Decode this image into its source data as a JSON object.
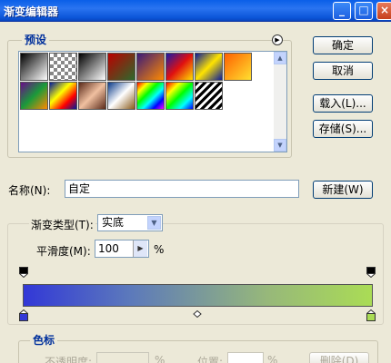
{
  "window": {
    "title": "渐变编辑器",
    "controls": {
      "minimize": "_",
      "maximize": "□",
      "close": "×"
    }
  },
  "presets": {
    "legend": "预设",
    "swatches": [
      {
        "name": "black-white",
        "css": "linear-gradient(135deg,#000,#fff)"
      },
      {
        "name": "checker-fade",
        "css": "repeating-conic-gradient(#888 0 25%, #fff 0 50%) 0 0/8px 8px"
      },
      {
        "name": "black-white-2",
        "css": "linear-gradient(135deg,#000,#fff)"
      },
      {
        "name": "red-green",
        "css": "linear-gradient(135deg,#b00,#2c6a2c)"
      },
      {
        "name": "violet-orange",
        "css": "linear-gradient(135deg,#3a1a7a,#ff8a00)"
      },
      {
        "name": "blue-red-yellow",
        "css": "linear-gradient(135deg,#1a1aa8,#e01010 50%,#ffe000)"
      },
      {
        "name": "blue-yellow-blue",
        "css": "linear-gradient(135deg,#0a1a9a,#ffe400 50%,#0a1a9a)"
      },
      {
        "name": "orange-yellow",
        "css": "linear-gradient(135deg,#ff6000,#ffe030)"
      },
      {
        "name": "violet-green-orange",
        "css": "linear-gradient(135deg,#6a0a8a,#1a9a3a 50%,#ff8a00)"
      },
      {
        "name": "stripes-rainbow",
        "css": "linear-gradient(135deg,#001a9a,#ff0 40%,#f00 70%,#001a9a)"
      },
      {
        "name": "copper",
        "css": "linear-gradient(135deg,#5a2a1a,#f0c0a0 50%,#5a2a1a)"
      },
      {
        "name": "chrome",
        "css": "linear-gradient(135deg,#0a3a8a,#fff 50%,#8a5a1a)"
      },
      {
        "name": "spectrum",
        "css": "linear-gradient(135deg,#f00,#ff0,#0f0,#0ff,#00f,#f0f)"
      },
      {
        "name": "transparent-rainbow",
        "css": "linear-gradient(135deg,#f00,#ff0,#0f0,#0ff,#00f)"
      },
      {
        "name": "transparent-stripes",
        "css": "repeating-linear-gradient(135deg,#000 0 3px,#fff 3px 6px)"
      }
    ]
  },
  "buttons": {
    "ok": "确定",
    "cancel": "取消",
    "load": "载入(L)...",
    "save": "存储(S)...",
    "new": "新建(W)"
  },
  "name_field": {
    "label": "名称(N):",
    "value": "自定"
  },
  "gradient": {
    "type_label": "渐变类型(T):",
    "type_value": "实底",
    "smoothness_label": "平滑度(M):",
    "smoothness_value": "100",
    "smoothness_unit": "%",
    "colors": {
      "start": "#3238d7",
      "end": "#aadc55"
    }
  },
  "stops": {
    "legend": "色标",
    "opacity_label": "不透明度:",
    "opacity_unit": "%",
    "position_label": "位置:",
    "position_unit": "%",
    "delete_label": "删除(D)"
  }
}
